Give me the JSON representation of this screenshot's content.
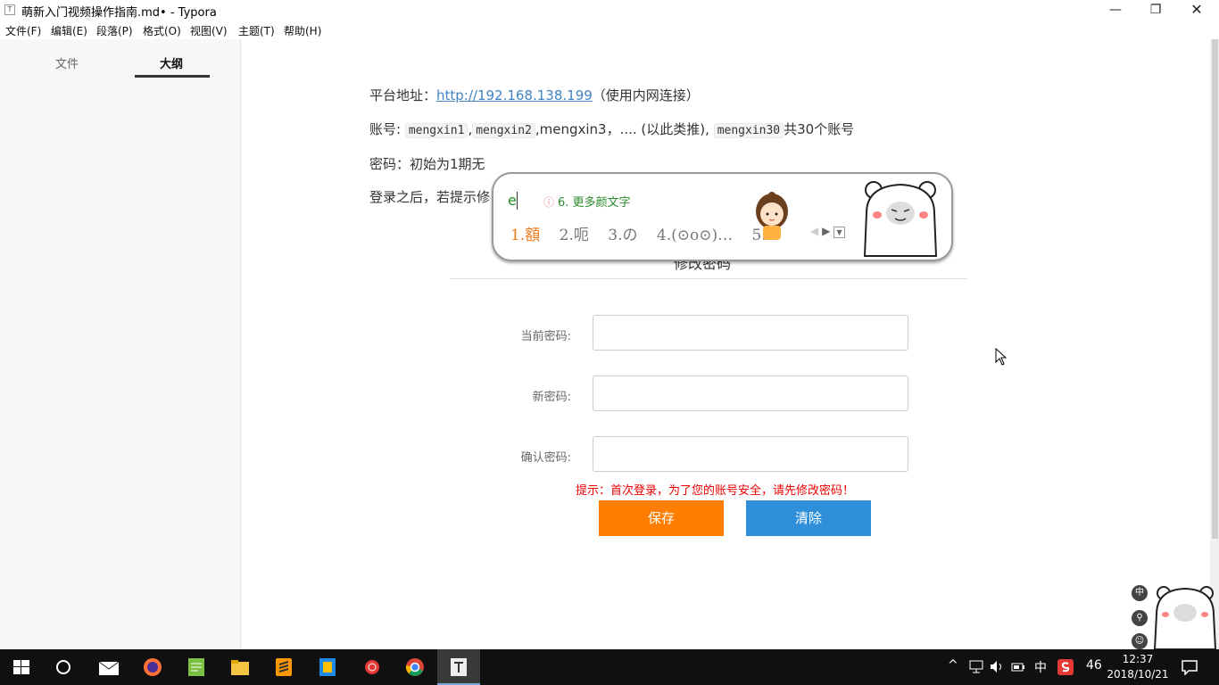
{
  "window": {
    "title": "萌新入门视频操作指南.md• - Typora",
    "app_icon": "T"
  },
  "menu": [
    "文件(F)",
    "编辑(E)",
    "段落(P)",
    "格式(O)",
    "视图(V)",
    "主题(T)",
    "帮助(H)"
  ],
  "sidebar": {
    "tabs": [
      "文件",
      "大纲"
    ],
    "active_tab": "大纲",
    "footer_back": "<",
    "footer_source": "</>"
  },
  "document": {
    "line1_prefix": "平台地址：",
    "line1_link": "http://192.168.138.199",
    "line1_suffix": "（使用内网连接）",
    "line2_prefix": "账号: ",
    "line2_code1": "mengxin1",
    "line2_sep1": ",",
    "line2_code2": "mengxin2",
    "line2_mid": ",mengxin3，.... (以此类推),",
    "line2_code3": "mengxin30",
    "line2_suffix": "共30个账号",
    "line3": "密码：初始为1期无",
    "line4": "登录之后，若提示修"
  },
  "embedded_form": {
    "title": "修改密码",
    "fields": [
      {
        "label": "当前密码:",
        "value": ""
      },
      {
        "label": "新密码:",
        "value": ""
      },
      {
        "label": "确认密码:",
        "value": ""
      }
    ],
    "hint": "提示：首次登录，为了您的账号安全，请先修改密码！",
    "save_label": "保存",
    "clear_label": "清除",
    "colors": {
      "save": "#ff7d00",
      "clear": "#2f8fd8",
      "hint": "#e00000"
    }
  },
  "ime": {
    "input": "e",
    "more_info_icon": "ⓘ",
    "more": "6. 更多颜文字",
    "candidates": [
      "1.額",
      "2.呃",
      "3.の",
      "4.(⊙o⊙)…",
      "5."
    ],
    "selected_index": 0
  },
  "taskbar": {
    "tray_items": [
      "^",
      "中",
      "46"
    ],
    "time": "12:37",
    "date": "2018/10/21",
    "corner_badges": [
      "中",
      "⚲",
      "☺"
    ]
  }
}
